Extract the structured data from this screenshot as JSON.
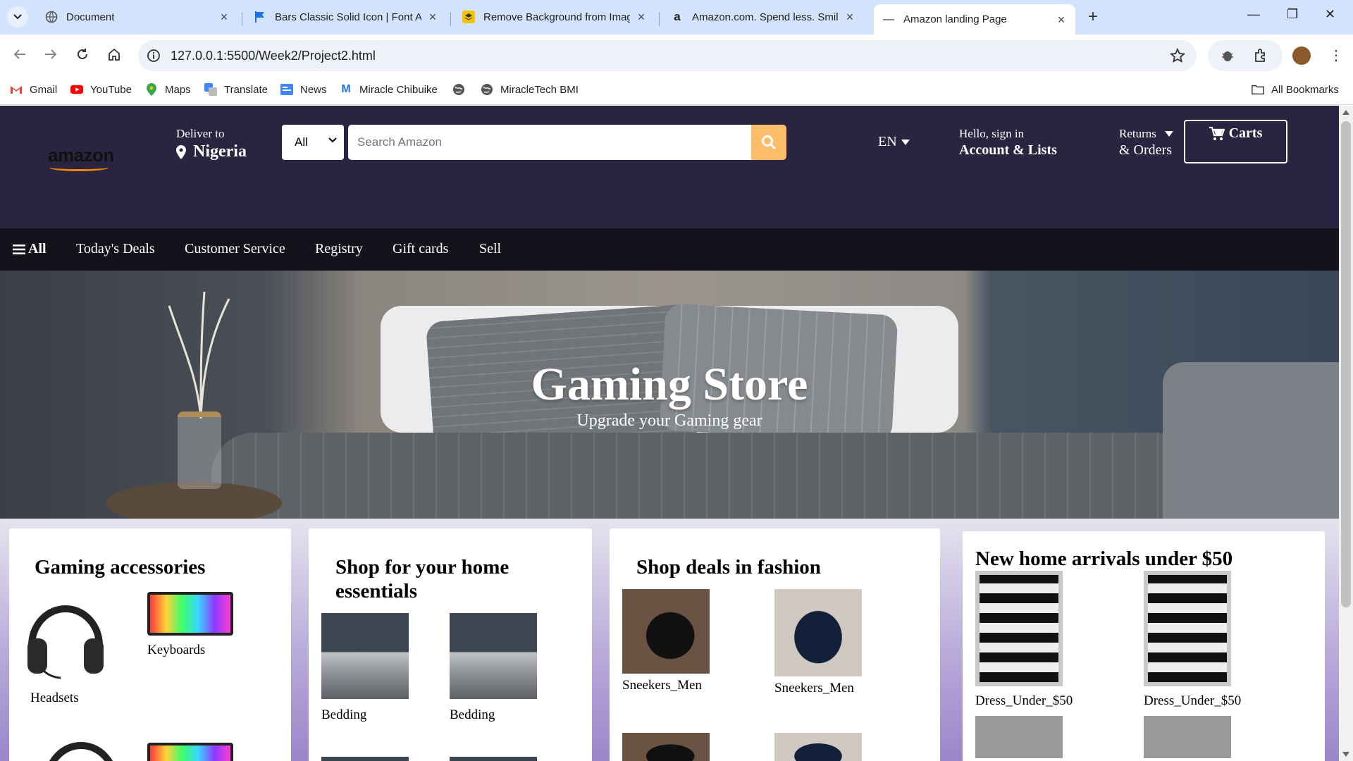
{
  "browser": {
    "tabs": [
      {
        "title": "Document",
        "favicon": "globe-icon",
        "active": false
      },
      {
        "title": "Bars Classic Solid Icon | Font Aw",
        "favicon": "flag-icon",
        "active": false
      },
      {
        "title": "Remove Background from Imag",
        "favicon": "remove-bg-icon",
        "active": false
      },
      {
        "title": "Amazon.com. Spend less. Smile",
        "favicon": "amazon-icon",
        "active": false
      },
      {
        "title": "Amazon landing Page",
        "favicon": "page-icon",
        "active": true
      }
    ],
    "url": "127.0.0.1:5500/Week2/Project2.html",
    "bookmarks": [
      {
        "label": "Gmail",
        "icon": "gmail-icon"
      },
      {
        "label": "YouTube",
        "icon": "youtube-icon"
      },
      {
        "label": "Maps",
        "icon": "maps-icon"
      },
      {
        "label": "Translate",
        "icon": "translate-icon"
      },
      {
        "label": "News",
        "icon": "news-icon"
      },
      {
        "label": "Miracle Chibuike",
        "icon": "m-icon"
      },
      {
        "label": "",
        "icon": "globe-icon"
      },
      {
        "label": "MiracleTech BMI",
        "icon": "globe-icon"
      }
    ],
    "all_bookmarks": "All Bookmarks"
  },
  "header": {
    "logo": "amazon",
    "deliver_small": "Deliver to",
    "deliver_big": "Nigeria",
    "search_category": "All",
    "search_placeholder": "Search Amazon",
    "language": "EN",
    "account_small": "Hello, sign in",
    "account_big": "Account & Lists",
    "returns_small": "Returns",
    "returns_big": "& Orders",
    "cart": "Carts"
  },
  "subnav": {
    "all": "All",
    "items": [
      "Today's Deals",
      "Customer Service",
      "Registry",
      "Gift cards",
      "Sell"
    ]
  },
  "hero": {
    "title": "Gaming Store",
    "subtitle": "Upgrade your Gaming gear"
  },
  "cards": [
    {
      "title": "Gaming accessories",
      "items": [
        "Headsets",
        "Keyboards"
      ]
    },
    {
      "title": "Shop for your home essentials",
      "items": [
        "Bedding",
        "Bedding"
      ]
    },
    {
      "title": "Shop deals in fashion",
      "items": [
        "Sneekers_Men",
        "Sneekers_Men"
      ]
    },
    {
      "title": "New home arrivals under $50",
      "items": [
        "Dress_Under_$50",
        "Dress_Under_$50"
      ]
    }
  ],
  "colors": {
    "header_bg": "#2b2440",
    "subnav_bg": "#14131c",
    "search_button": "#febd69",
    "tabbar": "#d3e3fd"
  }
}
